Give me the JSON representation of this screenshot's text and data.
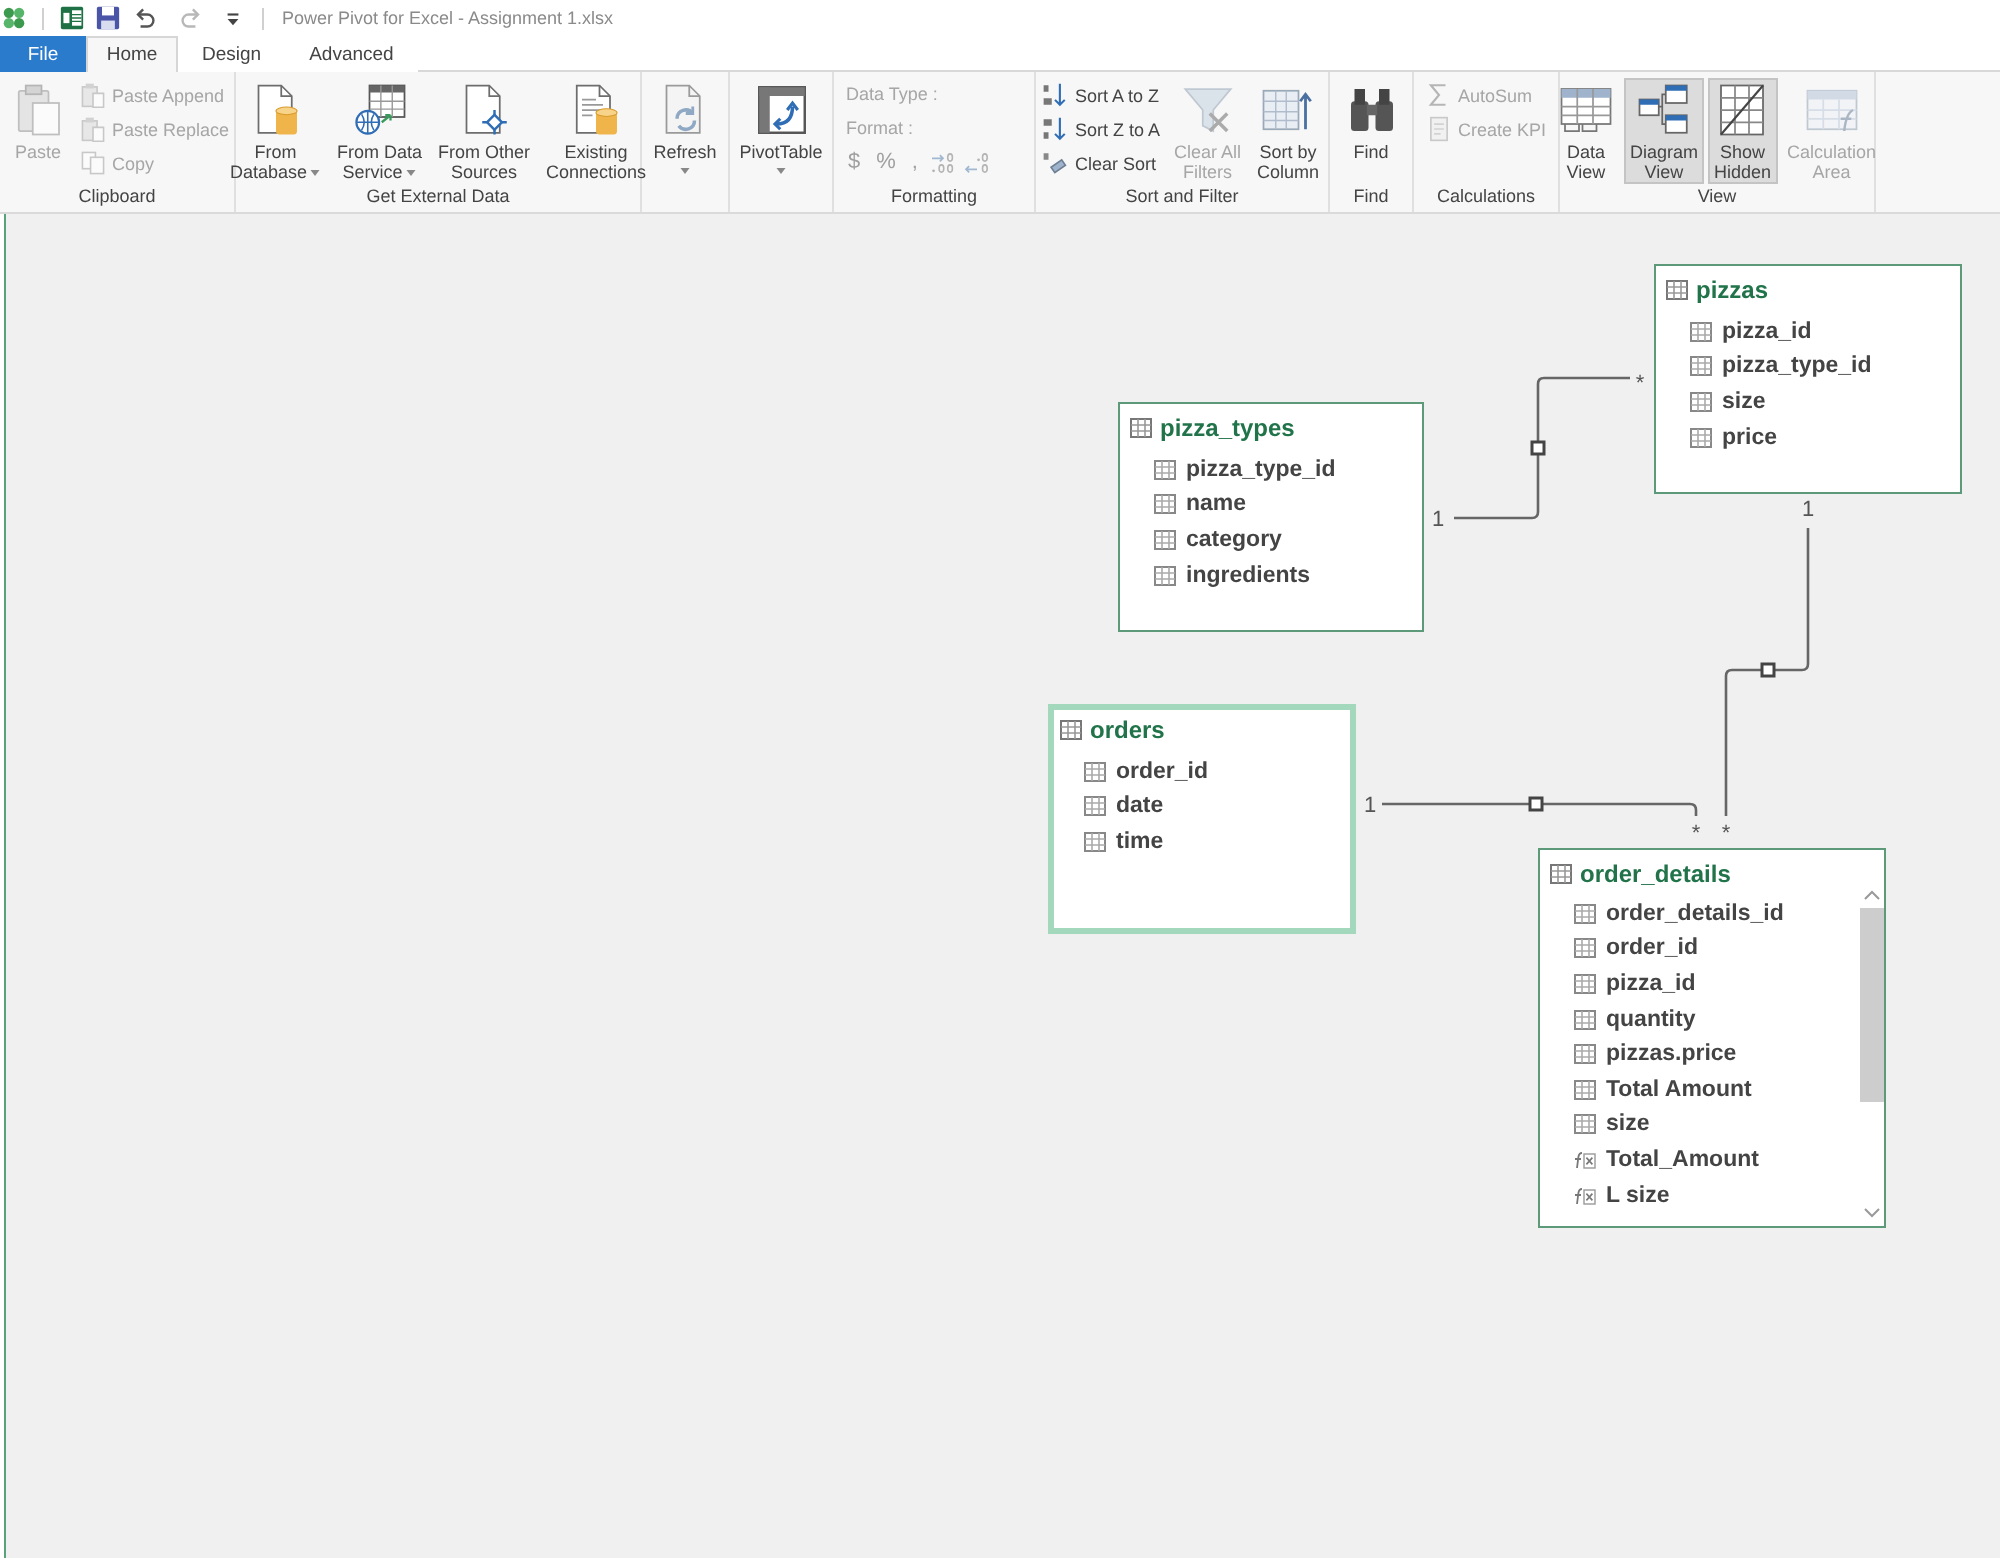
{
  "title_bar": {
    "title": "Power Pivot for Excel - Assignment 1.xlsx"
  },
  "tabs": [
    {
      "label": "File",
      "kind": "file",
      "selected": false
    },
    {
      "label": "Home",
      "kind": "tab",
      "selected": true
    },
    {
      "label": "Design",
      "kind": "tab",
      "selected": false
    },
    {
      "label": "Advanced",
      "kind": "tab",
      "selected": false
    }
  ],
  "ribbon": {
    "groups": [
      {
        "label": "Clipboard",
        "columns": [
          {
            "items": [
              {
                "kind": "large",
                "lines": [
                  "Paste"
                ],
                "dropdown": false,
                "disabled": true,
                "pressed": false
              }
            ]
          },
          {
            "items": [
              {
                "kind": "small",
                "label": "Paste Append",
                "disabled": true
              },
              {
                "kind": "small",
                "label": "Paste Replace",
                "disabled": true
              },
              {
                "kind": "small",
                "label": "Copy",
                "disabled": true
              }
            ]
          }
        ]
      },
      {
        "label": "Get External Data",
        "columns": [
          {
            "items": [
              {
                "kind": "large",
                "lines": [
                  "From",
                  "Database"
                ],
                "dropdown": true,
                "disabled": false,
                "pressed": false
              }
            ]
          },
          {
            "items": [
              {
                "kind": "large",
                "lines": [
                  "From Data",
                  "Service"
                ],
                "dropdown": true,
                "disabled": false,
                "pressed": false
              }
            ]
          },
          {
            "items": [
              {
                "kind": "large",
                "lines": [
                  "From Other",
                  "Sources"
                ],
                "dropdown": false,
                "disabled": false,
                "pressed": false
              }
            ]
          },
          {
            "items": [
              {
                "kind": "large",
                "lines": [
                  "Existing",
                  "Connections"
                ],
                "dropdown": false,
                "disabled": false,
                "pressed": false
              }
            ]
          }
        ]
      },
      {
        "columns": [
          {
            "items": [
              {
                "kind": "large",
                "lines": [
                  "Refresh"
                ],
                "dropdown": true,
                "disabled": false,
                "pressed": false
              }
            ]
          }
        ]
      },
      {
        "columns": [
          {
            "items": [
              {
                "kind": "large",
                "lines": [
                  "PivotTable"
                ],
                "dropdown": true,
                "disabled": false,
                "pressed": false
              }
            ]
          }
        ]
      },
      {
        "label": "Formatting",
        "columns": [
          {
            "items": [
              {
                "kind": "label",
                "label": "Data Type :",
                "disabled": true
              },
              {
                "kind": "label",
                "label": "Format :",
                "disabled": true
              },
              {
                "kind": "symbols",
                "symbols": [
                  "$",
                  "%",
                  ","
                ],
                "disabled": true
              }
            ]
          }
        ]
      },
      {
        "label": "Sort and Filter",
        "columns": [
          {
            "items": [
              {
                "kind": "small",
                "label": "Sort A to Z",
                "disabled": false
              },
              {
                "kind": "small",
                "label": "Sort Z to A",
                "disabled": false
              },
              {
                "kind": "small",
                "label": "Clear Sort",
                "disabled": false
              }
            ]
          },
          {
            "items": [
              {
                "kind": "large",
                "lines": [
                  "Clear All",
                  "Filters"
                ],
                "dropdown": false,
                "disabled": true,
                "pressed": false
              }
            ]
          },
          {
            "items": [
              {
                "kind": "large",
                "lines": [
                  "Sort by",
                  "Column"
                ],
                "dropdown": false,
                "disabled": false,
                "pressed": false
              }
            ]
          }
        ]
      },
      {
        "label": "Find",
        "columns": [
          {
            "items": [
              {
                "kind": "large",
                "lines": [
                  "Find"
                ],
                "dropdown": false,
                "disabled": false,
                "pressed": false
              }
            ]
          }
        ]
      },
      {
        "label": "Calculations",
        "columns": [
          {
            "items": [
              {
                "kind": "small",
                "label": "AutoSum",
                "disabled": true
              },
              {
                "kind": "small",
                "label": "Create KPI",
                "disabled": true
              }
            ]
          }
        ]
      },
      {
        "label": "View",
        "columns": [
          {
            "items": [
              {
                "kind": "large",
                "lines": [
                  "Data",
                  "View"
                ],
                "dropdown": false,
                "disabled": false,
                "pressed": false
              }
            ]
          },
          {
            "items": [
              {
                "kind": "large",
                "lines": [
                  "Diagram",
                  "View"
                ],
                "dropdown": false,
                "disabled": false,
                "pressed": true
              }
            ]
          },
          {
            "items": [
              {
                "kind": "large",
                "lines": [
                  "Show",
                  "Hidden"
                ],
                "dropdown": false,
                "disabled": false,
                "pressed": true
              }
            ]
          },
          {
            "items": [
              {
                "kind": "large",
                "lines": [
                  "Calculation",
                  "Area"
                ],
                "dropdown": false,
                "disabled": true,
                "pressed": false
              }
            ]
          }
        ]
      }
    ]
  },
  "diagram": {
    "tables": [
      {
        "name": "pizzas",
        "selected": false,
        "fields": [
          {
            "name": "pizza_id",
            "kind": "column"
          },
          {
            "name": "pizza_type_id",
            "kind": "column"
          },
          {
            "name": "size",
            "kind": "column"
          },
          {
            "name": "price",
            "kind": "column"
          }
        ]
      },
      {
        "name": "pizza_types",
        "selected": false,
        "fields": [
          {
            "name": "pizza_type_id",
            "kind": "column"
          },
          {
            "name": "name",
            "kind": "column"
          },
          {
            "name": "category",
            "kind": "column"
          },
          {
            "name": "ingredients",
            "kind": "column"
          }
        ]
      },
      {
        "name": "orders",
        "selected": true,
        "fields": [
          {
            "name": "order_id",
            "kind": "column"
          },
          {
            "name": "date",
            "kind": "column"
          },
          {
            "name": "time",
            "kind": "column"
          }
        ]
      },
      {
        "name": "order_details",
        "selected": false,
        "fields": [
          {
            "name": "order_details_id",
            "kind": "column"
          },
          {
            "name": "order_id",
            "kind": "column"
          },
          {
            "name": "pizza_id",
            "kind": "column"
          },
          {
            "name": "quantity",
            "kind": "column"
          },
          {
            "name": "pizzas.price",
            "kind": "column"
          },
          {
            "name": "Total Amount",
            "kind": "column"
          },
          {
            "name": "size",
            "kind": "column"
          },
          {
            "name": "Total_Amount",
            "kind": "measure"
          },
          {
            "name": "L size",
            "kind": "measure"
          }
        ]
      }
    ],
    "relationships": [
      {
        "one": "1",
        "many": "*"
      },
      {
        "one": "1",
        "many": "*"
      },
      {
        "one": "1",
        "many": "*"
      }
    ]
  }
}
